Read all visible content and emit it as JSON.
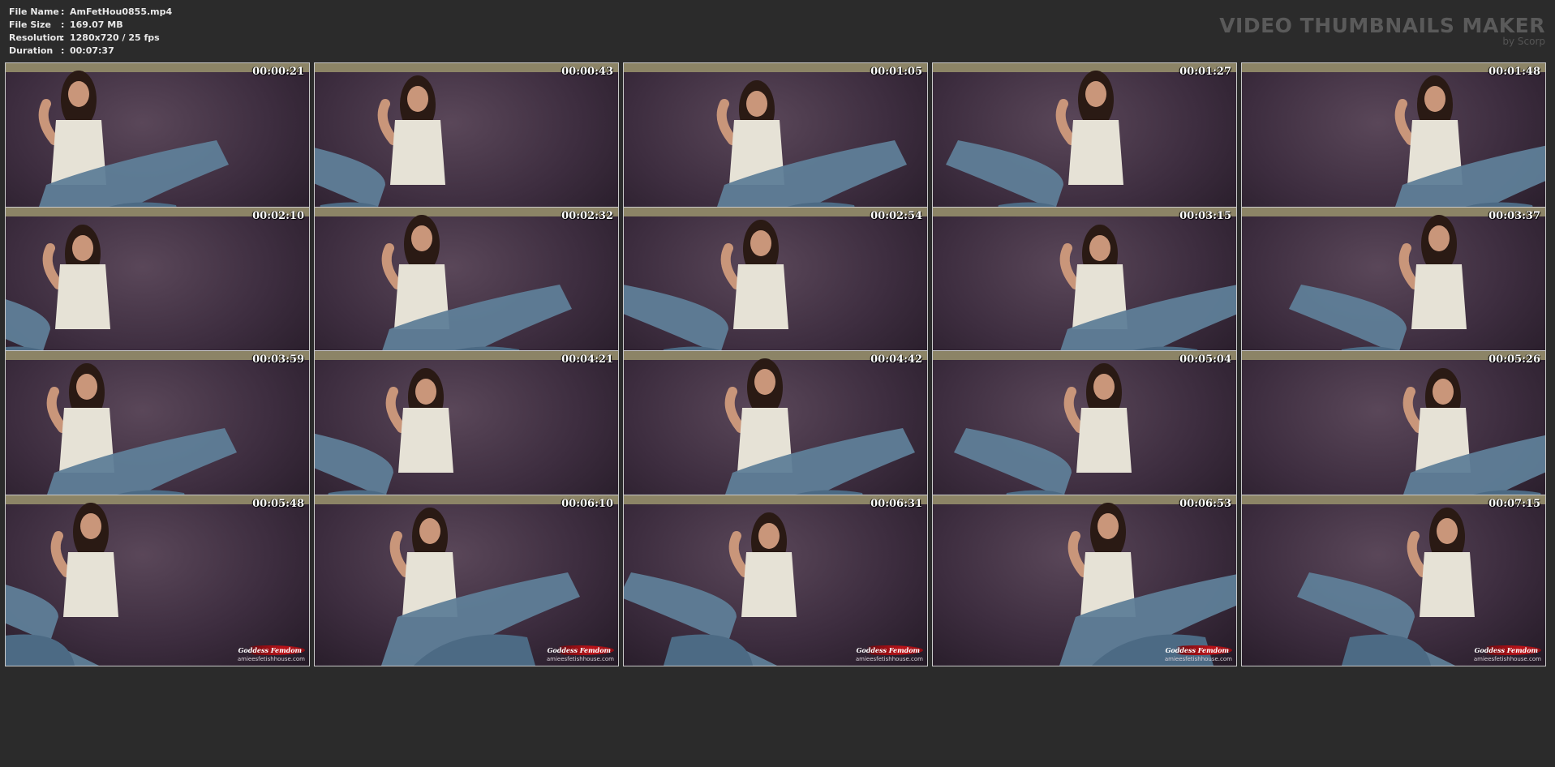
{
  "file_info": {
    "rows": [
      {
        "label": "File Name",
        "sep": ":",
        "value": "AmFetHou0855.mp4"
      },
      {
        "label": "File Size",
        "sep": ":",
        "value": "169.07 MB"
      },
      {
        "label": "Resolution",
        "sep": ":",
        "value": "1280x720 / 25 fps"
      },
      {
        "label": "Duration",
        "sep": ":",
        "value": "00:07:37"
      }
    ]
  },
  "brand": {
    "title": "VIDEO THUMBNAILS MAKER",
    "subtitle": "by Scorp"
  },
  "watermark": {
    "logo": "Goddess Femdom",
    "url": "amieesfetishhouse.com"
  },
  "thumbnails": [
    {
      "timestamp": "00:00:21"
    },
    {
      "timestamp": "00:00:43"
    },
    {
      "timestamp": "00:01:05"
    },
    {
      "timestamp": "00:01:27"
    },
    {
      "timestamp": "00:01:48"
    },
    {
      "timestamp": "00:02:10"
    },
    {
      "timestamp": "00:02:32"
    },
    {
      "timestamp": "00:02:54"
    },
    {
      "timestamp": "00:03:15"
    },
    {
      "timestamp": "00:03:37"
    },
    {
      "timestamp": "00:03:59"
    },
    {
      "timestamp": "00:04:21"
    },
    {
      "timestamp": "00:04:42"
    },
    {
      "timestamp": "00:05:04"
    },
    {
      "timestamp": "00:05:26"
    },
    {
      "timestamp": "00:05:48"
    },
    {
      "timestamp": "00:06:10"
    },
    {
      "timestamp": "00:06:31"
    },
    {
      "timestamp": "00:06:53"
    },
    {
      "timestamp": "00:07:15"
    }
  ],
  "colors": {
    "background": "#2b2b2b",
    "header_text": "#e8e8e8",
    "brand_text": "#5a5a5a",
    "thumb_border": "#c8c8c8",
    "wall": "#3d2d3f",
    "ceiling": "#8c8466",
    "stocking": "#5f7e98",
    "top": "#e6e2d6",
    "skin": "#c9967a",
    "hair": "#2a1a14",
    "logo_red": "#c0141a"
  }
}
